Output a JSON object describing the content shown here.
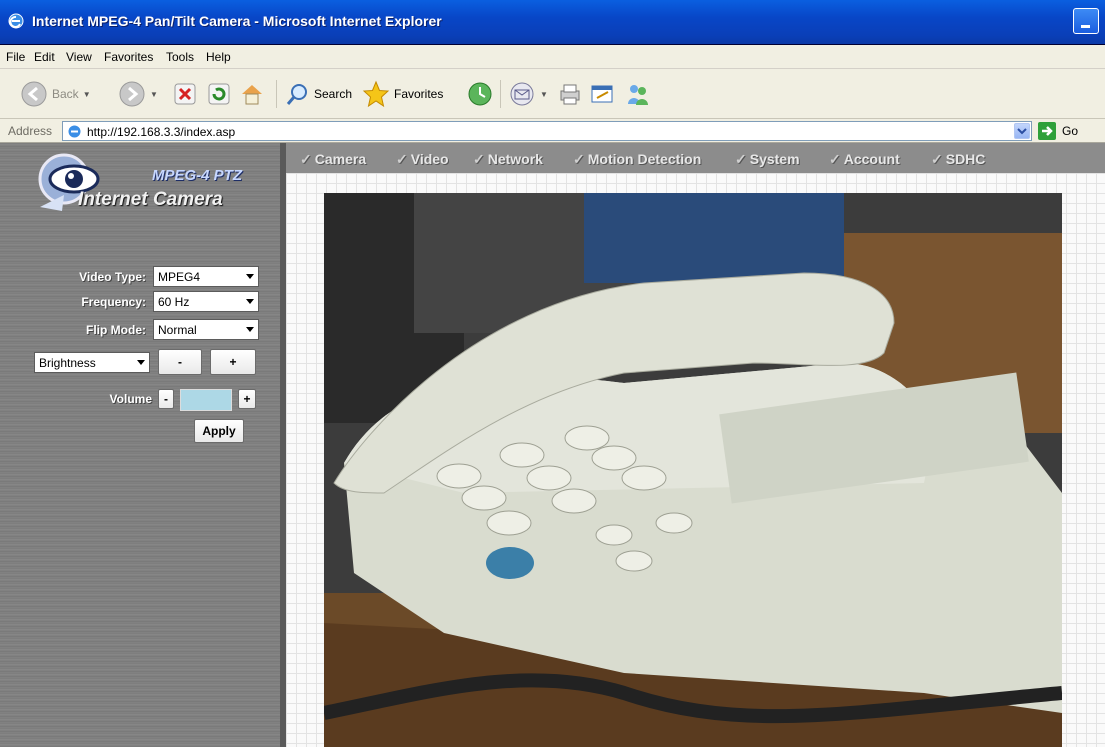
{
  "window": {
    "title": "Internet MPEG-4 Pan/Tilt Camera - Microsoft Internet Explorer"
  },
  "menu": [
    "File",
    "Edit",
    "View",
    "Favorites",
    "Tools",
    "Help"
  ],
  "toolbar": {
    "back": "Back",
    "search": "Search",
    "favorites": "Favorites"
  },
  "address": {
    "label": "Address",
    "url": "http://192.168.3.3/index.asp",
    "go": "Go"
  },
  "logo": {
    "product": "MPEG-4 PTZ",
    "brand": "Internet Camera"
  },
  "tabs": [
    "Camera",
    "Video",
    "Network",
    "Motion Detection",
    "System",
    "Account",
    "SDHC"
  ],
  "controls": {
    "video_type_label": "Video Type:",
    "video_type_value": "MPEG4",
    "frequency_label": "Frequency:",
    "frequency_value": "60 Hz",
    "flip_label": "Flip Mode:",
    "flip_value": "Normal",
    "brightness_value": "Brightness",
    "minus": "-",
    "plus": "+",
    "volume_label": "Volume",
    "apply": "Apply"
  },
  "colors": {
    "titlebar": "#0846c7",
    "sidebar": "#808080",
    "volume_level": "#add8e6"
  }
}
